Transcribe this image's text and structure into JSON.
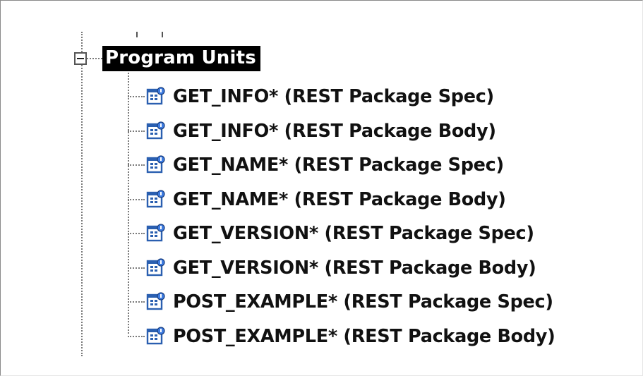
{
  "tree": {
    "root": {
      "label": "Program Units",
      "expander_icon": "collapse-minus-icon",
      "selected": true
    },
    "items": [
      {
        "label": "GET_INFO* (REST Package Spec)",
        "icon": "package-unit-icon"
      },
      {
        "label": "GET_INFO* (REST Package Body)",
        "icon": "package-unit-icon"
      },
      {
        "label": "GET_NAME* (REST Package Spec)",
        "icon": "package-unit-icon"
      },
      {
        "label": "GET_NAME* (REST Package Body)",
        "icon": "package-unit-icon"
      },
      {
        "label": "GET_VERSION* (REST Package Spec)",
        "icon": "package-unit-icon"
      },
      {
        "label": "GET_VERSION* (REST Package Body)",
        "icon": "package-unit-icon"
      },
      {
        "label": "POST_EXAMPLE* (REST Package Spec)",
        "icon": "package-unit-icon"
      },
      {
        "label": "POST_EXAMPLE* (REST Package Body)",
        "icon": "package-unit-icon"
      }
    ]
  },
  "colors": {
    "selection_background": "#000000",
    "selection_text": "#ffffff",
    "item_text": "#111111",
    "icon_blue": "#2a5fb0",
    "icon_accent": "#3d7be0"
  }
}
